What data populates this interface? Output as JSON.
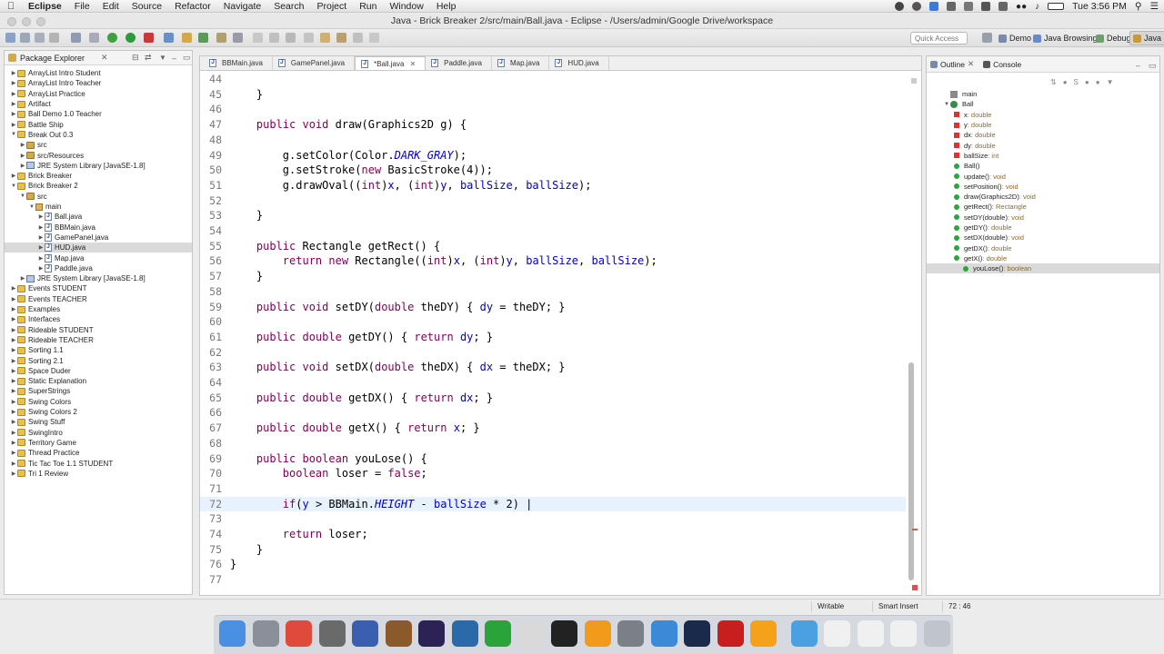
{
  "menubar": {
    "app": "Eclipse",
    "items": [
      "File",
      "Edit",
      "Source",
      "Refactor",
      "Navigate",
      "Search",
      "Project",
      "Run",
      "Window",
      "Help"
    ],
    "clock": "Tue 3:56 PM"
  },
  "window": {
    "title": "Java - Brick Breaker 2/src/main/Ball.java - Eclipse - /Users/admin/Google Drive/workspace"
  },
  "toolbar": {
    "quick_access_placeholder": "Quick Access",
    "perspectives": [
      "Demo",
      "Java Browsing",
      "Debug",
      "Java"
    ]
  },
  "package_explorer": {
    "title": "Package Explorer",
    "items": [
      {
        "label": "ArrayList Intro Student",
        "depth": 0,
        "icon": "project-icon"
      },
      {
        "label": "ArrayList Intro Teacher",
        "depth": 0,
        "icon": "project-icon"
      },
      {
        "label": "ArrayList Practice",
        "depth": 0,
        "icon": "project-icon"
      },
      {
        "label": "Artifact",
        "depth": 0,
        "icon": "project-icon"
      },
      {
        "label": "Ball Demo 1.0 Teacher",
        "depth": 0,
        "icon": "project-icon"
      },
      {
        "label": "Battle Ship",
        "depth": 0,
        "icon": "project-icon"
      },
      {
        "label": "Break Out 0.3",
        "depth": 0,
        "icon": "project-icon",
        "open": true
      },
      {
        "label": "src",
        "depth": 1,
        "icon": "source-folder-icon"
      },
      {
        "label": "src/Resources",
        "depth": 1,
        "icon": "source-folder-icon"
      },
      {
        "label": "JRE System Library [JavaSE-1.8]",
        "depth": 1,
        "icon": "library-icon"
      },
      {
        "label": "Brick Breaker",
        "depth": 0,
        "icon": "project-icon"
      },
      {
        "label": "Brick Breaker 2",
        "depth": 0,
        "icon": "project-icon",
        "open": true
      },
      {
        "label": "src",
        "depth": 1,
        "icon": "source-folder-icon",
        "open": true
      },
      {
        "label": "main",
        "depth": 2,
        "icon": "package-icon",
        "open": true
      },
      {
        "label": "Ball.java",
        "depth": 3,
        "icon": "java-file-icon"
      },
      {
        "label": "BBMain.java",
        "depth": 3,
        "icon": "java-file-icon"
      },
      {
        "label": "GamePanel.java",
        "depth": 3,
        "icon": "java-file-icon"
      },
      {
        "label": "HUD.java",
        "depth": 3,
        "icon": "java-file-icon",
        "selected": true
      },
      {
        "label": "Map.java",
        "depth": 3,
        "icon": "java-file-icon"
      },
      {
        "label": "Paddle.java",
        "depth": 3,
        "icon": "java-file-icon"
      },
      {
        "label": "JRE System Library [JavaSE-1.8]",
        "depth": 1,
        "icon": "library-icon"
      },
      {
        "label": "Events STUDENT",
        "depth": 0,
        "icon": "project-icon"
      },
      {
        "label": "Events TEACHER",
        "depth": 0,
        "icon": "project-icon"
      },
      {
        "label": "Examples",
        "depth": 0,
        "icon": "project-icon"
      },
      {
        "label": "Interfaces",
        "depth": 0,
        "icon": "project-icon"
      },
      {
        "label": "Rideable STUDENT",
        "depth": 0,
        "icon": "project-icon"
      },
      {
        "label": "Rideable TEACHER",
        "depth": 0,
        "icon": "project-icon"
      },
      {
        "label": "Sorting 1.1",
        "depth": 0,
        "icon": "project-icon"
      },
      {
        "label": "Sorting 2.1",
        "depth": 0,
        "icon": "project-icon"
      },
      {
        "label": "Space Duder",
        "depth": 0,
        "icon": "project-icon"
      },
      {
        "label": "Static Explanation",
        "depth": 0,
        "icon": "project-icon"
      },
      {
        "label": "SuperStrings",
        "depth": 0,
        "icon": "project-icon"
      },
      {
        "label": "Swing Colors",
        "depth": 0,
        "icon": "project-icon"
      },
      {
        "label": "Swing Colors 2",
        "depth": 0,
        "icon": "project-icon"
      },
      {
        "label": "Swing Stuff",
        "depth": 0,
        "icon": "project-icon"
      },
      {
        "label": "SwingIntro",
        "depth": 0,
        "icon": "project-icon"
      },
      {
        "label": "Territory Game",
        "depth": 0,
        "icon": "project-icon"
      },
      {
        "label": "Thread Practice",
        "depth": 0,
        "icon": "project-icon"
      },
      {
        "label": "Tic Tac Toe 1.1 STUDENT",
        "depth": 0,
        "icon": "project-icon"
      },
      {
        "label": "Tri 1 Review",
        "depth": 0,
        "icon": "project-icon"
      }
    ]
  },
  "editor": {
    "tabs": [
      {
        "label": "BBMain.java",
        "active": false
      },
      {
        "label": "GamePanel.java",
        "active": false
      },
      {
        "label": "*Ball.java",
        "active": true
      },
      {
        "label": "Paddle.java",
        "active": false
      },
      {
        "label": "Map.java",
        "active": false
      },
      {
        "label": "HUD.java",
        "active": false
      }
    ],
    "current_line": 72,
    "lines": [
      {
        "n": "44",
        "tokens": []
      },
      {
        "n": "45",
        "tokens": [
          {
            "t": "    }"
          }
        ]
      },
      {
        "n": "46",
        "tokens": []
      },
      {
        "n": "47",
        "tokens": [
          {
            "t": "    "
          },
          {
            "t": "public",
            "c": "kw"
          },
          {
            "t": " "
          },
          {
            "t": "void",
            "c": "kw"
          },
          {
            "t": " draw(Graphics2D g) {"
          }
        ]
      },
      {
        "n": "48",
        "tokens": []
      },
      {
        "n": "49",
        "tokens": [
          {
            "t": "        g.setColor(Color."
          },
          {
            "t": "DARK_GRAY",
            "c": "st"
          },
          {
            "t": ");"
          }
        ]
      },
      {
        "n": "50",
        "tokens": [
          {
            "t": "        g.setStroke("
          },
          {
            "t": "new",
            "c": "kw"
          },
          {
            "t": " BasicStroke(4));"
          }
        ]
      },
      {
        "n": "51",
        "tokens": [
          {
            "t": "        g.drawOval(("
          },
          {
            "t": "int",
            "c": "kw"
          },
          {
            "t": ")"
          },
          {
            "t": "x",
            "c": "fld"
          },
          {
            "t": ", ("
          },
          {
            "t": "int",
            "c": "kw"
          },
          {
            "t": ")"
          },
          {
            "t": "y",
            "c": "fld"
          },
          {
            "t": ", "
          },
          {
            "t": "ballSize",
            "c": "fld"
          },
          {
            "t": ", "
          },
          {
            "t": "ballSize",
            "c": "fld"
          },
          {
            "t": ");"
          }
        ]
      },
      {
        "n": "52",
        "tokens": []
      },
      {
        "n": "53",
        "tokens": [
          {
            "t": "    }"
          }
        ]
      },
      {
        "n": "54",
        "tokens": []
      },
      {
        "n": "55",
        "tokens": [
          {
            "t": "    "
          },
          {
            "t": "public",
            "c": "kw"
          },
          {
            "t": " Rectangle getRect() {"
          }
        ]
      },
      {
        "n": "56",
        "tokens": [
          {
            "t": "        "
          },
          {
            "t": "return",
            "c": "kw"
          },
          {
            "t": " "
          },
          {
            "t": "new",
            "c": "kw"
          },
          {
            "t": " Rectangle(("
          },
          {
            "t": "int",
            "c": "kw"
          },
          {
            "t": ")"
          },
          {
            "t": "x",
            "c": "fld"
          },
          {
            "t": ", ("
          },
          {
            "t": "int",
            "c": "kw"
          },
          {
            "t": ")"
          },
          {
            "t": "y",
            "c": "fld"
          },
          {
            "t": ", "
          },
          {
            "t": "ballSize",
            "c": "fld"
          },
          {
            "t": ", "
          },
          {
            "t": "ballSize",
            "c": "fld"
          },
          {
            "t": ");"
          }
        ]
      },
      {
        "n": "57",
        "tokens": [
          {
            "t": "    }"
          }
        ]
      },
      {
        "n": "58",
        "tokens": []
      },
      {
        "n": "59",
        "tokens": [
          {
            "t": "    "
          },
          {
            "t": "public",
            "c": "kw"
          },
          {
            "t": " "
          },
          {
            "t": "void",
            "c": "kw"
          },
          {
            "t": " setDY("
          },
          {
            "t": "double",
            "c": "kw"
          },
          {
            "t": " theDY) { "
          },
          {
            "t": "dy",
            "c": "fld"
          },
          {
            "t": " = theDY; }"
          }
        ]
      },
      {
        "n": "60",
        "tokens": []
      },
      {
        "n": "61",
        "tokens": [
          {
            "t": "    "
          },
          {
            "t": "public",
            "c": "kw"
          },
          {
            "t": " "
          },
          {
            "t": "double",
            "c": "kw"
          },
          {
            "t": " getDY() { "
          },
          {
            "t": "return",
            "c": "kw"
          },
          {
            "t": " "
          },
          {
            "t": "dy",
            "c": "fld"
          },
          {
            "t": "; }"
          }
        ]
      },
      {
        "n": "62",
        "tokens": []
      },
      {
        "n": "63",
        "tokens": [
          {
            "t": "    "
          },
          {
            "t": "public",
            "c": "kw"
          },
          {
            "t": " "
          },
          {
            "t": "void",
            "c": "kw"
          },
          {
            "t": " setDX("
          },
          {
            "t": "double",
            "c": "kw"
          },
          {
            "t": " theDX) { "
          },
          {
            "t": "dx",
            "c": "fld"
          },
          {
            "t": " = theDX; }"
          }
        ]
      },
      {
        "n": "64",
        "tokens": []
      },
      {
        "n": "65",
        "tokens": [
          {
            "t": "    "
          },
          {
            "t": "public",
            "c": "kw"
          },
          {
            "t": " "
          },
          {
            "t": "double",
            "c": "kw"
          },
          {
            "t": " getDX() { "
          },
          {
            "t": "return",
            "c": "kw"
          },
          {
            "t": " "
          },
          {
            "t": "dx",
            "c": "fld"
          },
          {
            "t": "; }"
          }
        ]
      },
      {
        "n": "66",
        "tokens": []
      },
      {
        "n": "67",
        "tokens": [
          {
            "t": "    "
          },
          {
            "t": "public",
            "c": "kw"
          },
          {
            "t": " "
          },
          {
            "t": "double",
            "c": "kw"
          },
          {
            "t": " getX() { "
          },
          {
            "t": "return",
            "c": "kw"
          },
          {
            "t": " "
          },
          {
            "t": "x",
            "c": "fld"
          },
          {
            "t": "; }"
          }
        ]
      },
      {
        "n": "68",
        "tokens": []
      },
      {
        "n": "69",
        "tokens": [
          {
            "t": "    "
          },
          {
            "t": "public",
            "c": "kw"
          },
          {
            "t": " "
          },
          {
            "t": "boolean",
            "c": "kw"
          },
          {
            "t": " youLose() {"
          }
        ]
      },
      {
        "n": "70",
        "tokens": [
          {
            "t": "        "
          },
          {
            "t": "boolean",
            "c": "kw"
          },
          {
            "t": " loser = "
          },
          {
            "t": "false",
            "c": "kw"
          },
          {
            "t": ";"
          }
        ]
      },
      {
        "n": "71",
        "tokens": []
      },
      {
        "n": "72",
        "tokens": [
          {
            "t": "        "
          },
          {
            "t": "if",
            "c": "kw"
          },
          {
            "t": "("
          },
          {
            "t": "y",
            "c": "fld"
          },
          {
            "t": " > BBMain."
          },
          {
            "t": "HEIGHT",
            "c": "st"
          },
          {
            "t": " - "
          },
          {
            "t": "ballSize",
            "c": "fld"
          },
          {
            "t": " * 2) |"
          }
        ]
      },
      {
        "n": "73",
        "tokens": []
      },
      {
        "n": "74",
        "tokens": [
          {
            "t": "        "
          },
          {
            "t": "return",
            "c": "kw"
          },
          {
            "t": " loser;"
          }
        ]
      },
      {
        "n": "75",
        "tokens": [
          {
            "t": "    }"
          }
        ]
      },
      {
        "n": "76",
        "tokens": [
          {
            "t": "}"
          }
        ]
      },
      {
        "n": "77",
        "tokens": []
      }
    ]
  },
  "outline": {
    "tabs": [
      "Outline",
      "Console"
    ],
    "items": [
      {
        "label": "main",
        "depth": 0,
        "kind": "package"
      },
      {
        "label": "Ball",
        "depth": 0,
        "kind": "class"
      },
      {
        "label": "x",
        "type": " : double",
        "depth": 1,
        "kind": "private"
      },
      {
        "label": "y",
        "type": " : double",
        "depth": 1,
        "kind": "private"
      },
      {
        "label": "dx",
        "type": " : double",
        "depth": 1,
        "kind": "private"
      },
      {
        "label": "dy",
        "type": " : double",
        "depth": 1,
        "kind": "private"
      },
      {
        "label": "ballSize",
        "type": " : int",
        "depth": 1,
        "kind": "private"
      },
      {
        "label": "Ball()",
        "type": "",
        "depth": 1,
        "kind": "public"
      },
      {
        "label": "update()",
        "type": " : void",
        "depth": 1,
        "kind": "public"
      },
      {
        "label": "setPosition()",
        "type": " : void",
        "depth": 1,
        "kind": "public"
      },
      {
        "label": "draw(Graphics2D)",
        "type": " : void",
        "depth": 1,
        "kind": "public"
      },
      {
        "label": "getRect()",
        "type": " : Rectangle",
        "depth": 1,
        "kind": "public"
      },
      {
        "label": "setDY(double)",
        "type": " : void",
        "depth": 1,
        "kind": "public"
      },
      {
        "label": "getDY()",
        "type": " : double",
        "depth": 1,
        "kind": "public"
      },
      {
        "label": "setDX(double)",
        "type": " : void",
        "depth": 1,
        "kind": "public"
      },
      {
        "label": "getDX()",
        "type": " : double",
        "depth": 1,
        "kind": "public"
      },
      {
        "label": "getX()",
        "type": " : double",
        "depth": 1,
        "kind": "public"
      },
      {
        "label": "youLose()",
        "type": " : boolean",
        "depth": 1,
        "kind": "public",
        "selected": true
      }
    ]
  },
  "status": {
    "writable": "Writable",
    "insert_mode": "Smart Insert",
    "position": "72 : 46"
  },
  "dock": {
    "apps": [
      {
        "name": "finder-icon",
        "color": "#4a90e2"
      },
      {
        "name": "launchpad-icon",
        "color": "#8a8f99"
      },
      {
        "name": "chrome-icon",
        "color": "#e04a3a"
      },
      {
        "name": "calculator-icon",
        "color": "#6a6a6a"
      },
      {
        "name": "instruments-icon",
        "color": "#3a5fb0"
      },
      {
        "name": "guitar-icon",
        "color": "#8a5a2a"
      },
      {
        "name": "eclipse-icon",
        "color": "#2c2255"
      },
      {
        "name": "quicktime-icon",
        "color": "#2a6aa8"
      },
      {
        "name": "messages-icon",
        "color": "#2aa33a"
      },
      {
        "name": "grid-app-icon",
        "color": "#d9d9d9"
      },
      {
        "name": "activity-monitor-icon",
        "color": "#222222"
      },
      {
        "name": "illustrator-icon",
        "color": "#f29a1a"
      },
      {
        "name": "utilities-icon",
        "color": "#7a7f88"
      },
      {
        "name": "textedit-icon",
        "color": "#3a8ad8"
      },
      {
        "name": "photoshop-icon",
        "color": "#1a2a4a"
      },
      {
        "name": "acrobat-icon",
        "color": "#c81e1e"
      },
      {
        "name": "opera-icon",
        "color": "#f5a21a"
      },
      {
        "name": "folder-icon",
        "color": "#4aa0e0"
      },
      {
        "name": "document-icon",
        "color": "#f0f0f0"
      },
      {
        "name": "document-icon",
        "color": "#f0f0f0"
      },
      {
        "name": "document-icon",
        "color": "#f0f0f0"
      },
      {
        "name": "trash-icon",
        "color": "#c0c4cc"
      }
    ]
  }
}
